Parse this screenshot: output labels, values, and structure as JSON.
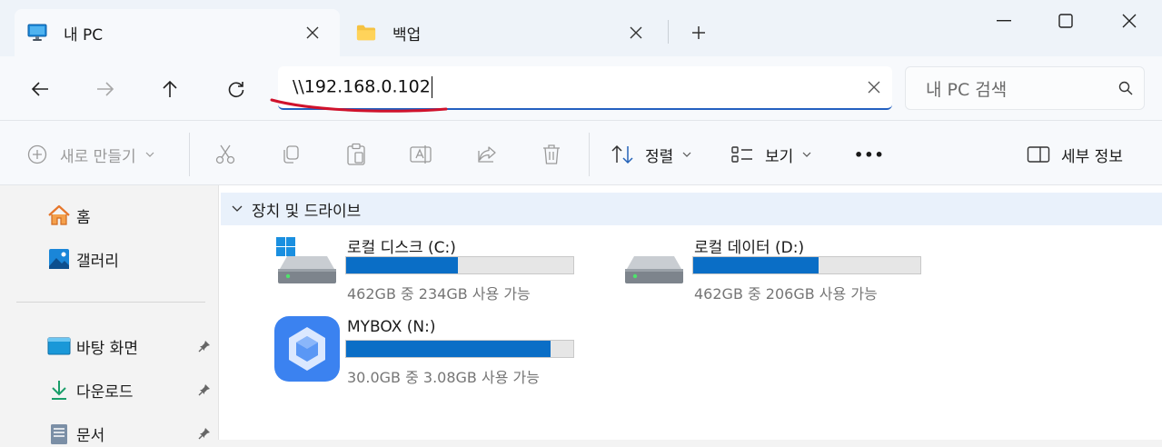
{
  "tabs": [
    {
      "label": "내 PC",
      "icon": "monitor-icon"
    },
    {
      "label": "백업",
      "icon": "folder-icon"
    }
  ],
  "address": {
    "value": "\\\\192.168.0.102"
  },
  "search": {
    "placeholder": "내 PC 검색"
  },
  "commands": {
    "new": "새로 만들기",
    "sort": "정렬",
    "view": "보기",
    "more": "•••",
    "details": "세부 정보"
  },
  "sidebar": {
    "items": [
      {
        "label": "홈",
        "icon": "home-icon"
      },
      {
        "label": "갤러리",
        "icon": "gallery-icon"
      },
      {
        "label": "바탕 화면",
        "icon": "desktop-icon",
        "pinned": true
      },
      {
        "label": "다운로드",
        "icon": "download-icon",
        "pinned": true
      },
      {
        "label": "문서",
        "icon": "documents-icon",
        "pinned": true
      }
    ]
  },
  "main": {
    "group_title": "장치 및 드라이브",
    "drives": [
      {
        "name": "로컬 디스크 (C:)",
        "free_text": "462GB 중 234GB 사용 가능",
        "used_fraction": 0.49,
        "icon": "windows-drive-icon"
      },
      {
        "name": "로컬 데이터 (D:)",
        "free_text": "462GB 중 206GB 사용 가능",
        "used_fraction": 0.55,
        "icon": "drive-icon"
      },
      {
        "name": "MYBOX (N:)",
        "free_text": "30.0GB 중 3.08GB 사용 가능",
        "used_fraction": 0.9,
        "icon": "mybox-icon"
      }
    ]
  },
  "colors": {
    "accent": "#0a6ec6",
    "address_underline": "#2360c0",
    "annotation": "#d0122c"
  }
}
